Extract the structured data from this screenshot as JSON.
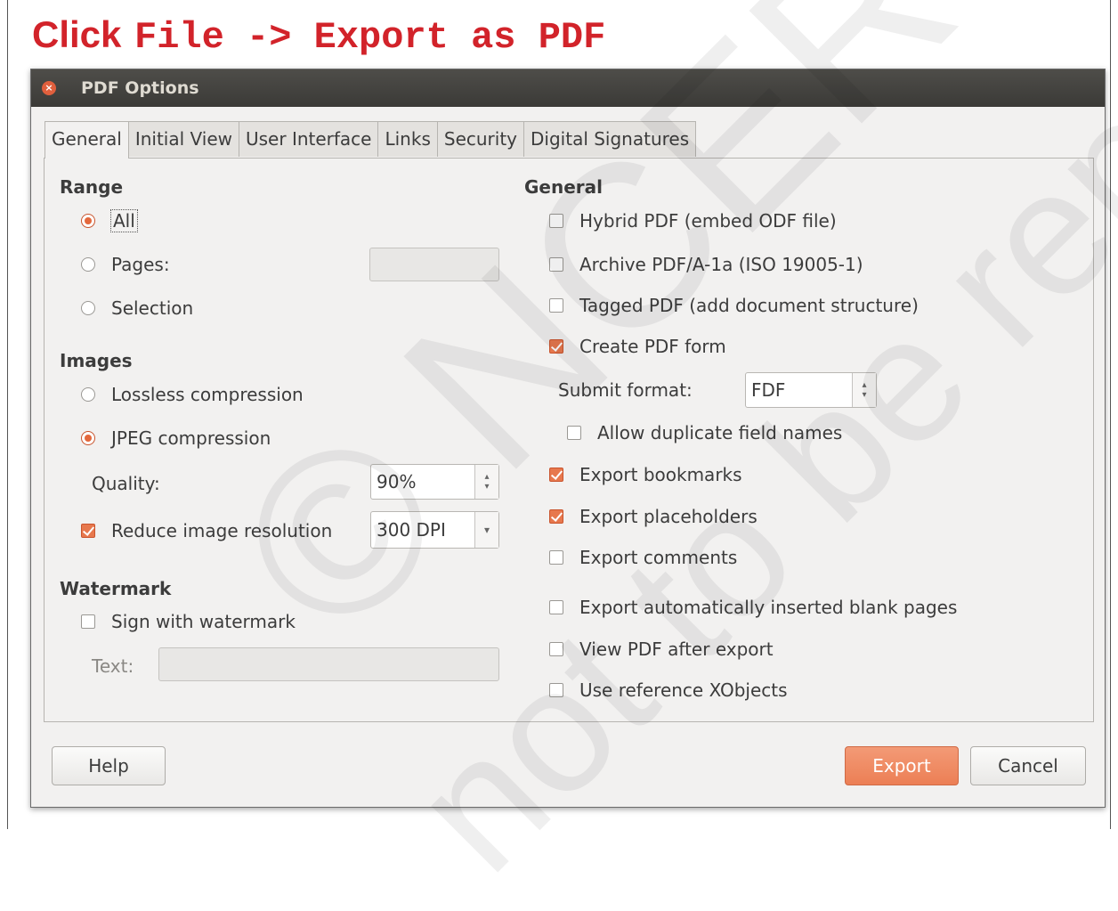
{
  "instruction": {
    "word": "Click",
    "command": "File -> Export as PDF"
  },
  "watermark": {
    "line1": "© NCERT",
    "line2": "not to be republished"
  },
  "dialog": {
    "title": "PDF Options",
    "tabs": [
      "General",
      "Initial View",
      "User Interface",
      "Links",
      "Security",
      "Digital Signatures"
    ],
    "active_tab": "General",
    "range": {
      "heading": "Range",
      "options": [
        {
          "label": "All",
          "selected": true
        },
        {
          "label": "Pages:",
          "selected": false
        },
        {
          "label": "Selection",
          "selected": false
        }
      ],
      "pages_value": ""
    },
    "images": {
      "heading": "Images",
      "options": [
        {
          "label": "Lossless compression",
          "selected": false
        },
        {
          "label": "JPEG compression",
          "selected": true
        }
      ],
      "quality_label": "Quality:",
      "quality_value": "90%",
      "reduce_label": "Reduce image resolution",
      "reduce_checked": true,
      "resolution_value": "300 DPI"
    },
    "watermark_section": {
      "heading": "Watermark",
      "sign_label": "Sign with watermark",
      "sign_checked": false,
      "text_label": "Text:",
      "text_value": ""
    },
    "general": {
      "heading": "General",
      "options": [
        {
          "label": "Hybrid PDF (embed ODF file)",
          "checked": false
        },
        {
          "label": "Archive PDF/A-1a (ISO 19005-1)",
          "checked": false
        },
        {
          "label": "Tagged PDF (add document structure)",
          "checked": false
        },
        {
          "label": "Create PDF form",
          "checked": true
        }
      ],
      "submit_label": "Submit format:",
      "submit_value": "FDF",
      "allow_dup_label": "Allow duplicate field names",
      "allow_dup_checked": false,
      "more_options": [
        {
          "label": "Export bookmarks",
          "checked": true
        },
        {
          "label": "Export placeholders",
          "checked": true
        },
        {
          "label": "Export comments",
          "checked": false
        },
        {
          "label": "Export automatically inserted blank pages",
          "checked": false
        },
        {
          "label": "View PDF after export",
          "checked": false
        },
        {
          "label": "Use reference XObjects",
          "checked": false
        }
      ]
    },
    "buttons": {
      "help": "Help",
      "export": "Export",
      "cancel": "Cancel"
    }
  }
}
